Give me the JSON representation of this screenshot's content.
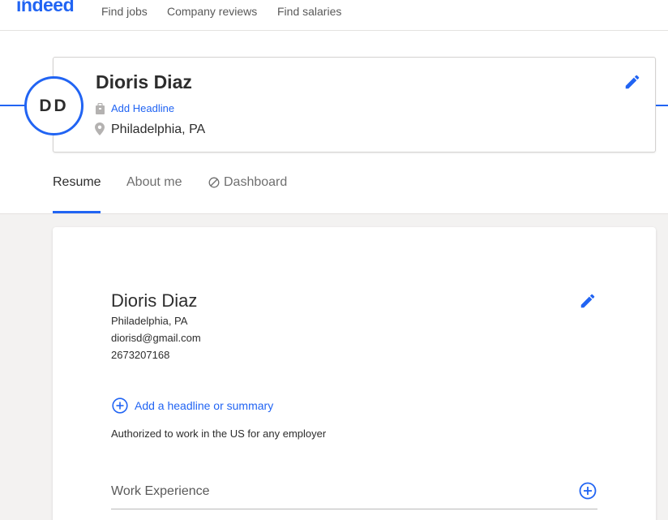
{
  "nav": {
    "logo": "indeed",
    "links": [
      "Find jobs",
      "Company reviews",
      "Find salaries"
    ]
  },
  "profile": {
    "initials": "DD",
    "name": "Dioris Diaz",
    "headline_link": "Add Headline",
    "location": "Philadelphia, PA",
    "headline_icon": "briefcase-icon",
    "location_icon": "location-pin-icon",
    "edit_icon": "pencil-icon"
  },
  "tabs": [
    {
      "label": "Resume",
      "active": true
    },
    {
      "label": "About me",
      "active": false
    },
    {
      "label": "Dashboard",
      "active": false,
      "icon": "prohibited-icon"
    }
  ],
  "resume": {
    "name": "Dioris Diaz",
    "location": "Philadelphia, PA",
    "email": "diorisd@gmail.com",
    "phone": "2673207168",
    "add_summary": "Add a headline or summary",
    "authorization": "Authorized to work in the US for any employer",
    "sections": [
      {
        "title": "Work Experience",
        "icon": "add-circle-icon"
      }
    ]
  },
  "colors": {
    "accent": "#2164f3",
    "text": "#2d2d2d",
    "muted": "#6f6f6f",
    "background_grey": "#f3f2f1"
  }
}
